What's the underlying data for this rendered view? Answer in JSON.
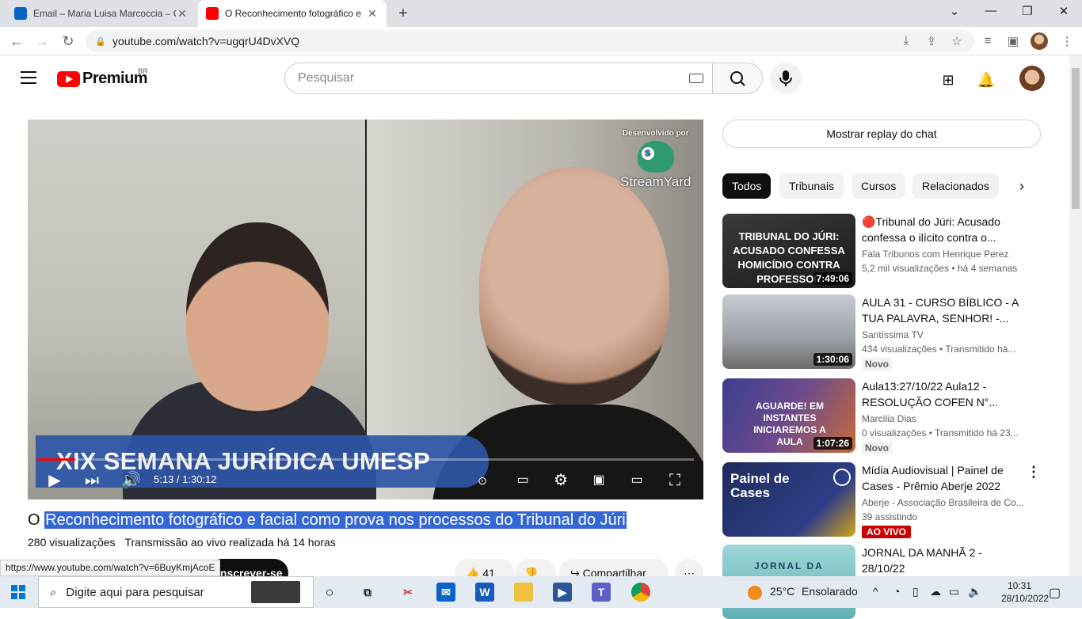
{
  "browser": {
    "tabs": [
      {
        "title": "Email – Maria Luisa Marcoccia – O",
        "favicon": "outlook-icon",
        "active": false
      },
      {
        "title": "O Reconhecimento fotográfico e",
        "favicon": "youtube-icon",
        "active": true
      }
    ],
    "url": "youtube.com/watch?v=ugqrU4DvXVQ",
    "status_url": "https://www.youtube.com/watch?v=6BuyKmjAcoE"
  },
  "youtube": {
    "logo_text": "Premium",
    "region": "BR",
    "search_placeholder": "Pesquisar"
  },
  "player": {
    "streamyard_caption": "Desenvolvido por",
    "streamyard_brand": "StreamYard",
    "banner_text": "XIX SEMANA JURÍDICA UMESP",
    "time_current": "5:13",
    "time_total": "1:30:12",
    "time_display": "5:13 / 1:30:12",
    "progress_fraction": 0.058
  },
  "video": {
    "title_prefix": "O ",
    "title_highlighted": "Reconhecimento fotográfico e facial como prova nos processos do Tribunal do Júri",
    "views": "280 visualizações",
    "stream_info": "Transmissão ao vivo realizada há 14 horas",
    "subscribe_label": "Inscrever-se",
    "likes": "41",
    "share_label": "Compartilhar"
  },
  "sidebar": {
    "chat_replay_label": "Mostrar replay do chat",
    "chips": [
      "Todos",
      "Tribunais",
      "Cursos",
      "Relacionados"
    ],
    "recommendations": [
      {
        "title": "🔴Tribunal do Júri: Acusado confessa o ilícito contra o...",
        "channel": "Fala Tribunos com Henrique Perez",
        "stats": "5,2 mil visualizações  •  há 4 semanas",
        "duration": "7:49:06",
        "thumb_text": "TRIBUNAL DO JÚRI: ACUSADO CONFESSA HOMICÍDIO CONTRA PROFESSOR"
      },
      {
        "title": "AULA 31 - CURSO BÍBLICO - A TUA PALAVRA, SENHOR! -...",
        "channel": "Santíssima TV",
        "stats": "434 visualizações  •  Transmitido há...",
        "duration": "1:30:06",
        "badge": "Novo"
      },
      {
        "title": "Aula13:27/10/22 Aula12 - RESOLUÇÃO COFEN N°...",
        "channel": "Marcilia Dias",
        "stats": "0 visualizações  •  Transmitido há 23...",
        "duration": "1:07:26",
        "badge": "Novo",
        "thumb_text": "AGUARDE! EM INSTANTES INICIAREMOS A AULA"
      },
      {
        "title": "Mídia Audiovisual | Painel de Cases - Prêmio Aberje 2022",
        "channel": "Aberje - Associação Brasileira de Co...",
        "stats": "39 assistindo",
        "live": "AO VIVO",
        "thumb_text": "Painel de Cases"
      },
      {
        "title": "JORNAL DA MANHÃ 2 - 28/10/22",
        "channel": "",
        "stats": "",
        "thumb_text": "JORNAL DA"
      }
    ]
  },
  "taskbar": {
    "search_placeholder": "Digite aqui para pesquisar",
    "weather_temp": "25°C",
    "weather_text": "Ensolarado",
    "time": "10:31",
    "date": "28/10/2022"
  }
}
